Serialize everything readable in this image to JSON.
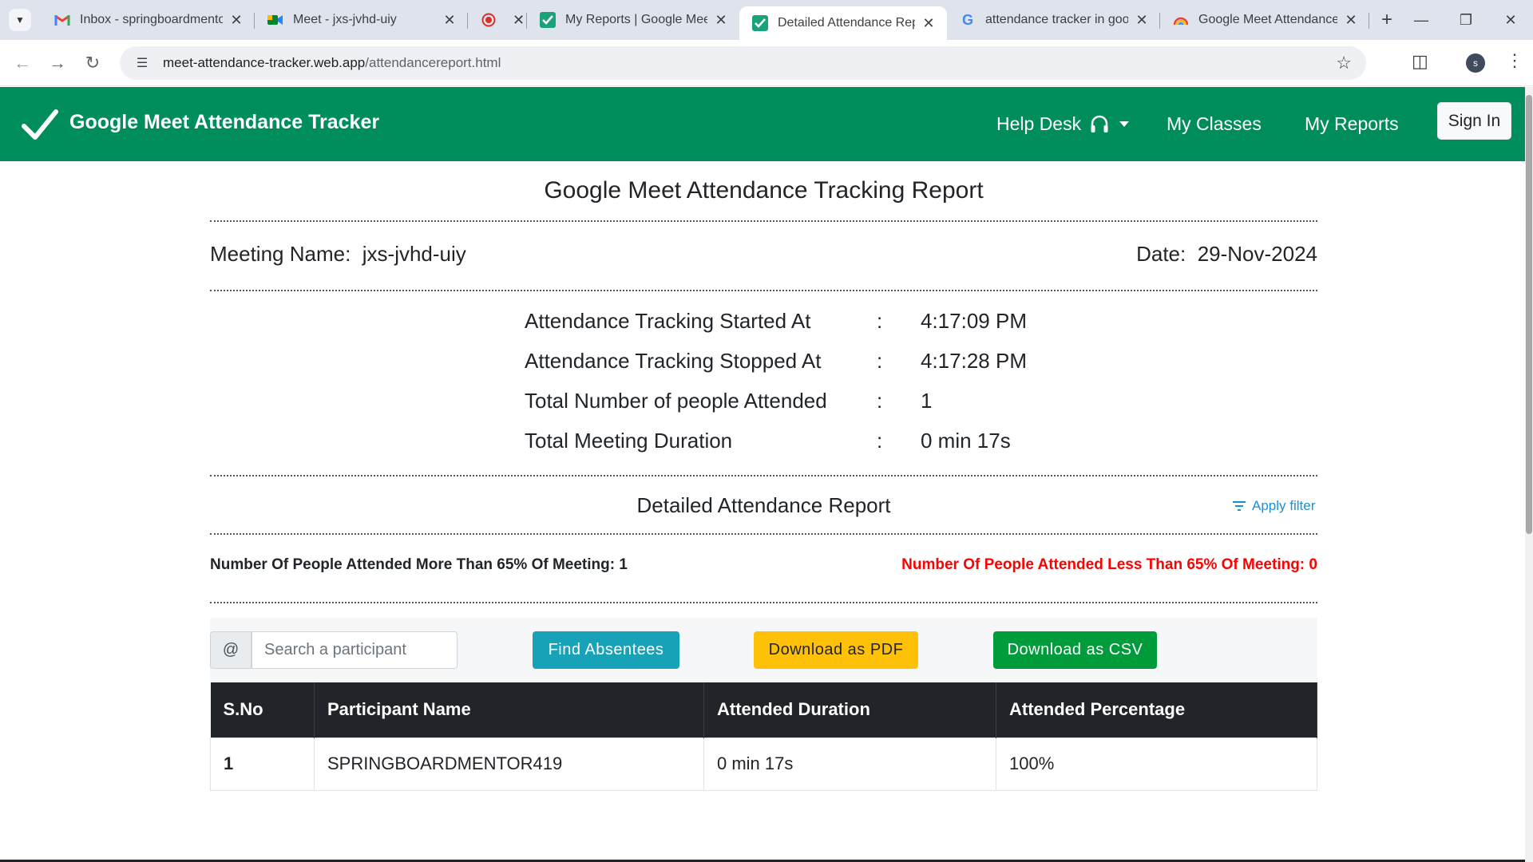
{
  "browser": {
    "tabs": [
      {
        "title": "Inbox - springboardmento",
        "icon": "gmail-icon",
        "active": false
      },
      {
        "title": "Meet - jxs-jvhd-uiy",
        "icon": "google-meet-icon",
        "active": false
      },
      {
        "title": "",
        "icon": "recording-icon",
        "active": false
      },
      {
        "title": "My Reports | Google Meet",
        "icon": "attendance-check-icon",
        "active": false
      },
      {
        "title": "Detailed Attendance Repor",
        "icon": "attendance-check-icon",
        "active": true
      },
      {
        "title": "attendance tracker in goog",
        "icon": "google-icon",
        "active": false
      },
      {
        "title": "Google Meet Attendance T",
        "icon": "rainbow-icon",
        "active": false
      }
    ],
    "url_domain": "meet-attendance-tracker.web.app",
    "url_path": "/attendancereport.html",
    "profile_initial": "s"
  },
  "navbar": {
    "brand": "Google Meet Attendance Tracker",
    "help_desk": "Help Desk",
    "my_classes": "My Classes",
    "my_reports": "My Reports",
    "sign_in": "Sign In",
    "brand_color": "#008d5c"
  },
  "report": {
    "title": "Google Meet Attendance Tracking Report",
    "meeting_name_label": "Meeting Name:",
    "meeting_name": "jxs-jvhd-uiy",
    "date_label": "Date:",
    "date": "29-Nov-2024",
    "stats": [
      {
        "label": "Attendance Tracking Started At",
        "value": "4:17:09 PM"
      },
      {
        "label": "Attendance Tracking Stopped At",
        "value": "4:17:28 PM"
      },
      {
        "label": "Total Number of people Attended",
        "value": "1"
      },
      {
        "label": "Total Meeting Duration",
        "value": "0 min 17s"
      }
    ],
    "detail_title": "Detailed Attendance Report",
    "apply_filter": "Apply filter",
    "more_than_label": "Number Of People Attended More Than 65% Of Meeting:",
    "more_than_value": "1",
    "less_than_label": "Number Of People Attended Less Than 65% Of Meeting:",
    "less_than_value": "0"
  },
  "actions": {
    "at_symbol": "@",
    "search_placeholder": "Search a participant",
    "find_absentees": "Find Absentees",
    "download_pdf": "Download as PDF",
    "download_csv": "Download as CSV"
  },
  "table": {
    "headers": [
      "S.No",
      "Participant Name",
      "Attended Duration",
      "Attended Percentage"
    ],
    "rows": [
      [
        "1",
        "SPRINGBOARDMENTOR419",
        "0 min 17s",
        "100%"
      ]
    ]
  }
}
